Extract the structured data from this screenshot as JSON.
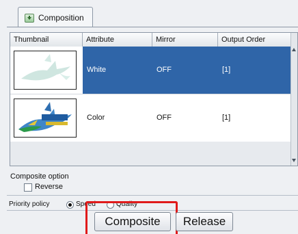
{
  "tab": {
    "label": "Composition"
  },
  "table": {
    "columns": [
      "Thumbnail",
      "Attribute",
      "Mirror",
      "Output Order"
    ],
    "rows": [
      {
        "attribute": "White",
        "mirror": "OFF",
        "output_order": "[1]",
        "selected": true
      },
      {
        "attribute": "Color",
        "mirror": "OFF",
        "output_order": "[1]",
        "selected": false
      }
    ]
  },
  "composite_option": {
    "title": "Composite option",
    "reverse_label": "Reverse",
    "reverse_checked": false
  },
  "priority_policy": {
    "label": "Priority policy",
    "options": [
      "Speed",
      "Quality"
    ],
    "selected": "Speed"
  },
  "buttons": {
    "composite": "Composite",
    "release": "Release"
  },
  "colors": {
    "selection": "#2f65a8",
    "highlight": "#e01a1a"
  }
}
